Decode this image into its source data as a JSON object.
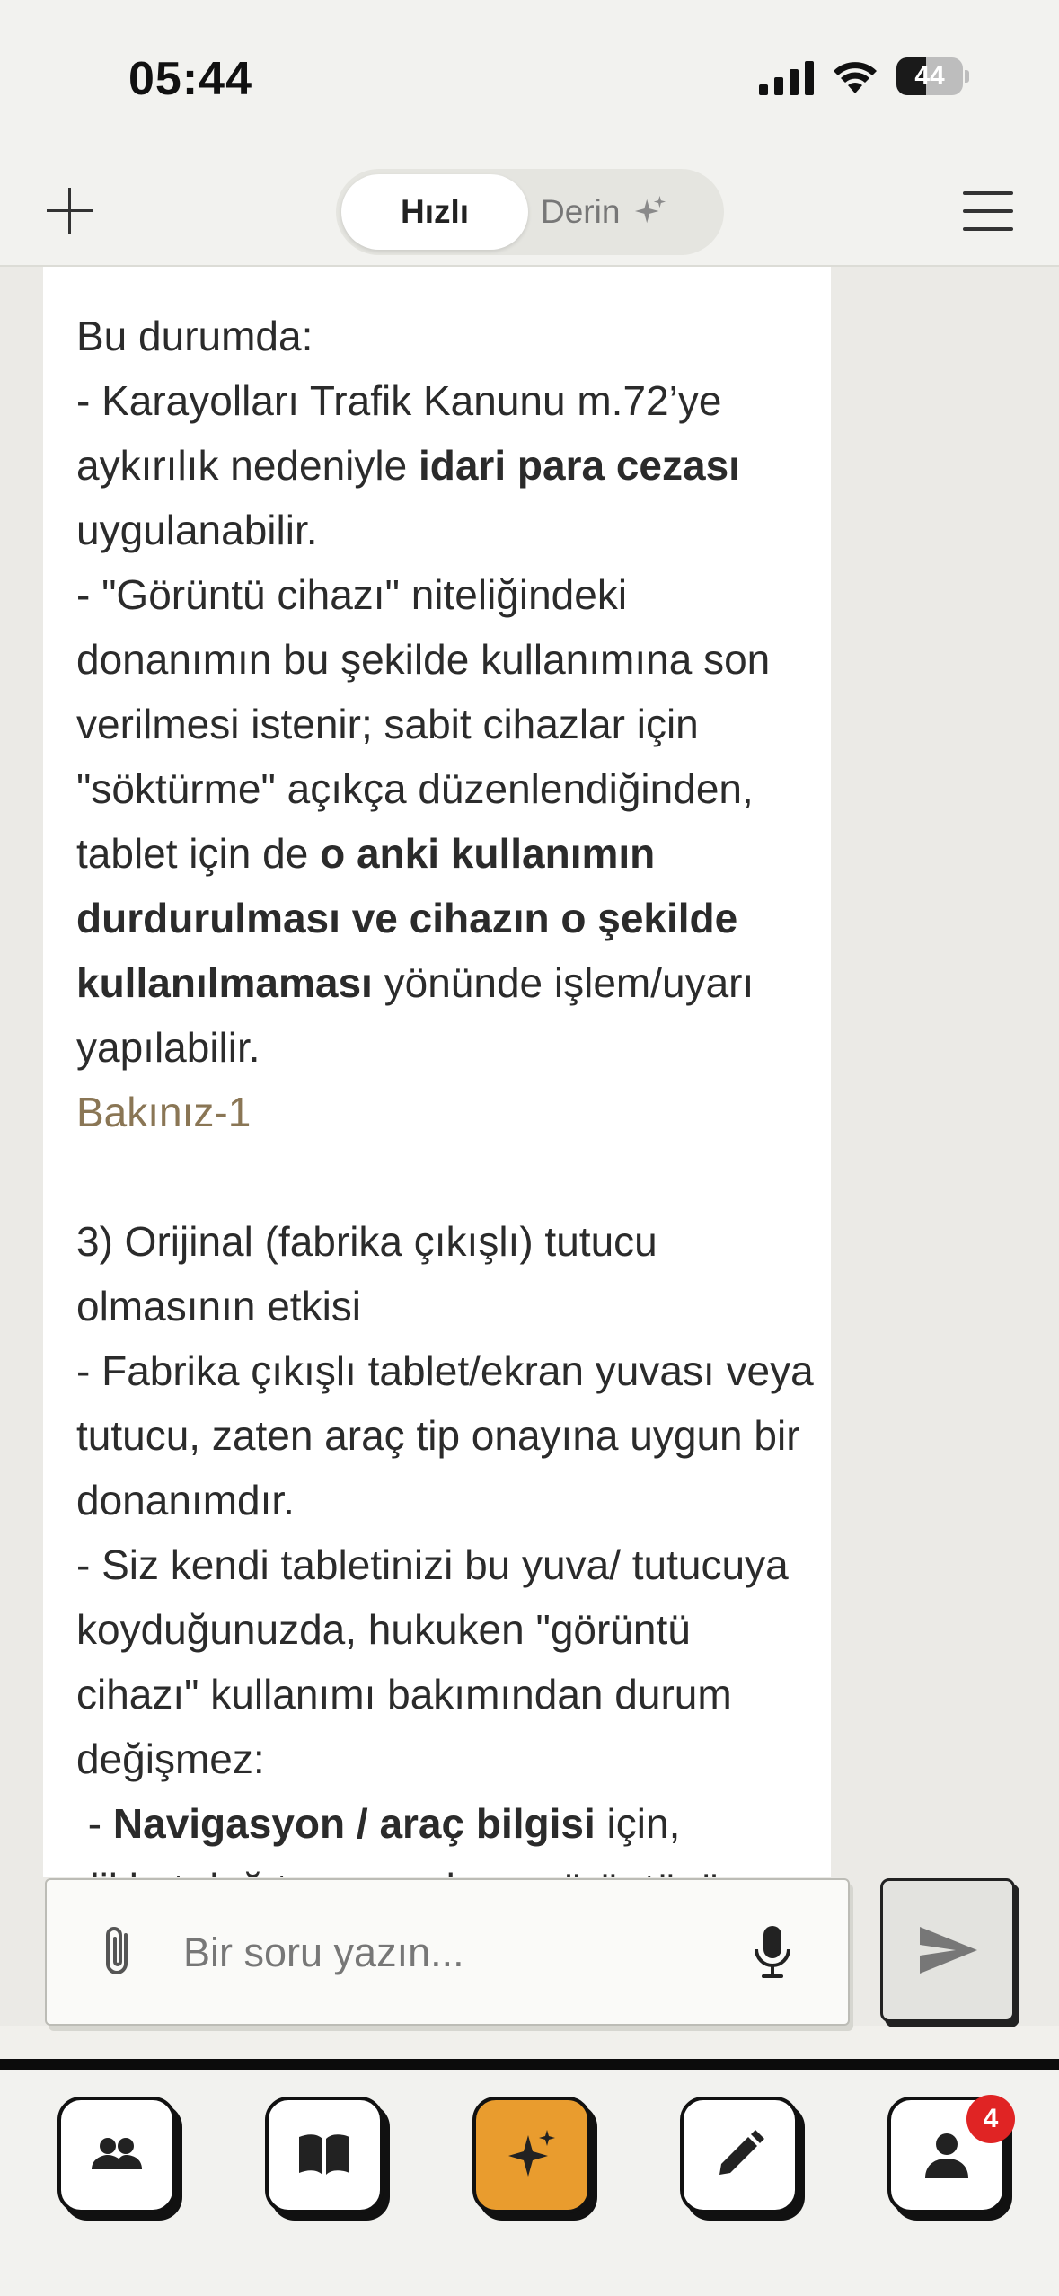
{
  "status_bar": {
    "time": "05:44",
    "battery_level": "44",
    "battery_fraction": 0.44,
    "icons": [
      "cellular-signal-icon",
      "wifi-icon",
      "battery-icon"
    ]
  },
  "header": {
    "new_chat_icon": "plus-icon",
    "mode_options": [
      "Hızlı",
      "Derin"
    ],
    "selected_mode": "Hızlı",
    "deep_mode_icon": "sparkle-icon",
    "menu_icon": "hamburger-menu-icon"
  },
  "answer": {
    "line_1": "Bu durumda:",
    "p1_part1": "- Karayolları Trafik Kanunu m.72’ye aykırılık nedeniyle ",
    "p1_bold": "idari para cezası",
    "p1_part2": " uygulanabilir.",
    "p2_part1": "- \"Görüntü cihazı\" niteliğindeki donanımın bu şekilde kullanımına son verilmesi istenir; sabit cihazlar için \"söktürme\" açıkça düzenlendiğinden, tablet için de ",
    "p2_bold": "o anki kullanımın durdurulması ve cihazın o şekilde kullanılmaması",
    "p2_part2": " yönünde işlem/uyarı yapılabilir.",
    "reference_link": "Bakınız-1",
    "section_3_heading": "3) Orijinal (fabrika çıkışlı) tutucu olmasının etkisi",
    "p3": "- Fabrika çıkışlı tablet/ekran yuvası veya tutucu, zaten araç tip onayına uygun bir donanımdır.",
    "p4": "- Siz kendi tabletinizi bu yuva/ tutucuya koyduğunuzda, hukuken \"görüntü cihazı\" kullanımı bakımından durum değişmez:",
    "p5_prefix": " - ",
    "p5_bold": "Navigasyon / araç bilgisi",
    "p5_suffix": " için,",
    "p6_partial": "dikkat dağıtmayan ekran görüntüsü"
  },
  "input": {
    "placeholder": "Bir soru yazın...",
    "attach_icon": "paperclip-icon",
    "mic_icon": "microphone-icon",
    "send_icon": "send-icon"
  },
  "bottom_nav": {
    "items": [
      {
        "icon": "people-icon",
        "active": false
      },
      {
        "icon": "book-icon",
        "active": false
      },
      {
        "icon": "sparkle-icon",
        "active": true
      },
      {
        "icon": "pencil-icon",
        "active": false
      },
      {
        "icon": "profile-icon",
        "active": false
      }
    ],
    "profile_badge": "4"
  },
  "colors": {
    "background": "#ebeae6",
    "card": "#ffffff",
    "accent": "#e99c2e",
    "link": "#8a7655",
    "badge": "#e02424"
  }
}
